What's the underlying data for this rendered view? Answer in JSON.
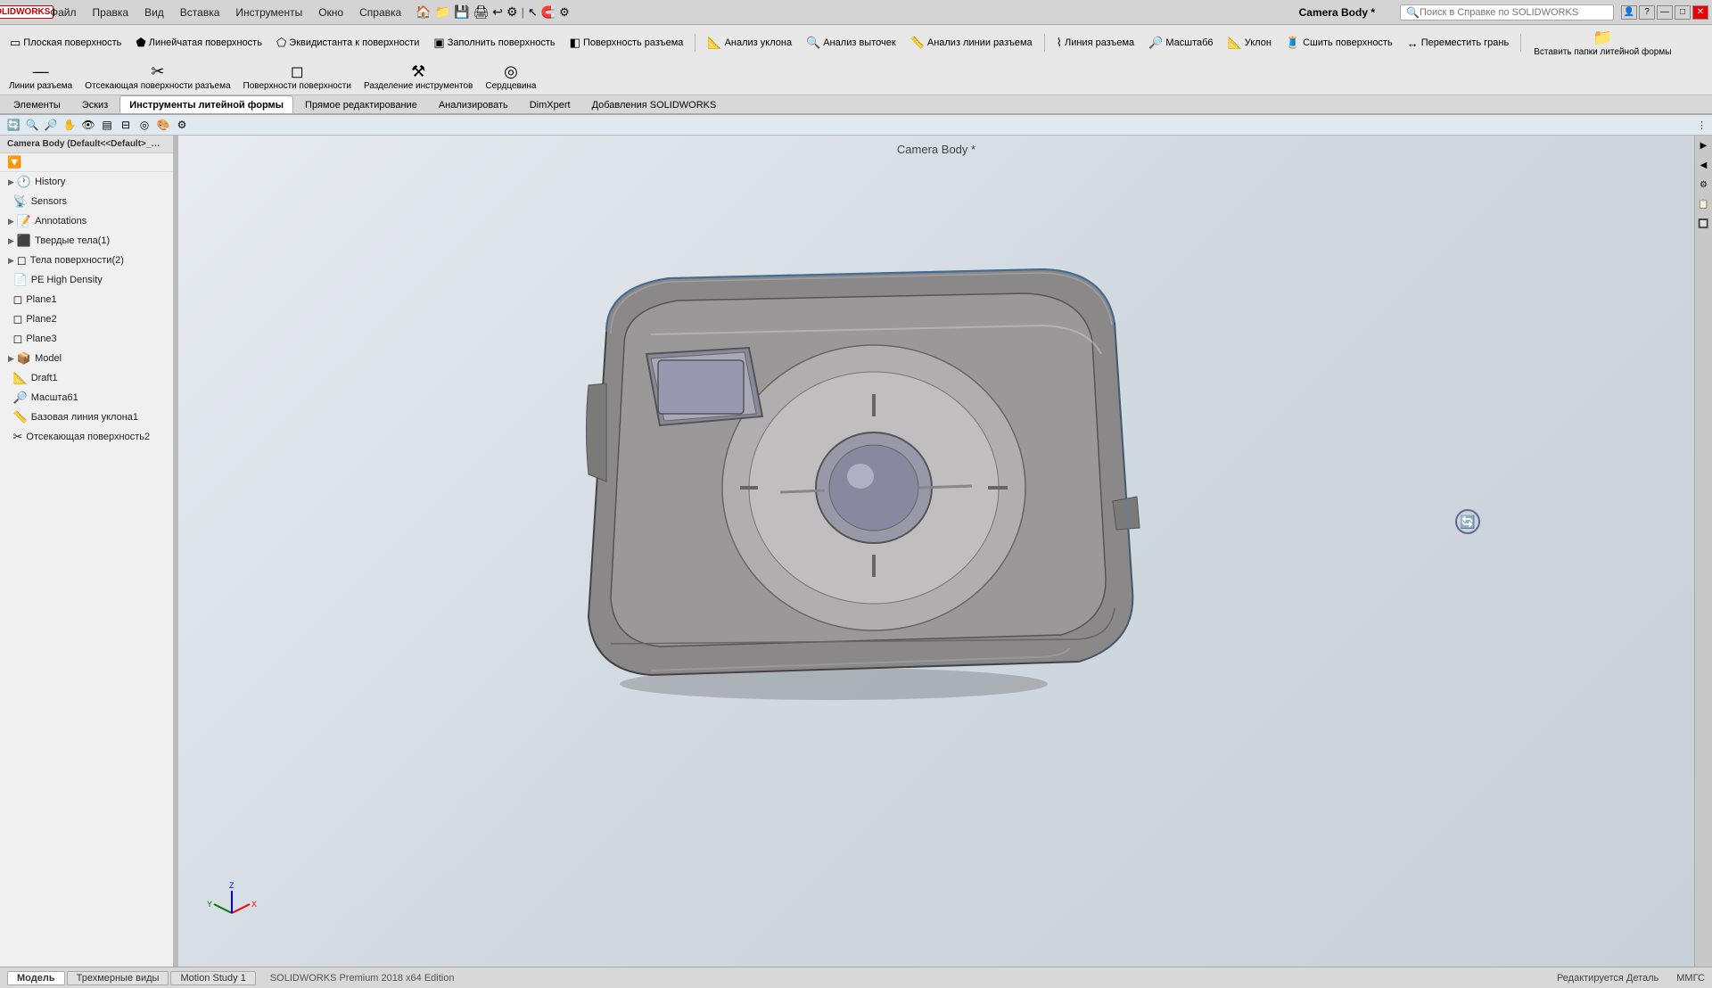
{
  "app": {
    "title": "Camera Body *",
    "logo": "SW",
    "company": "SOLIDWORKS"
  },
  "menubar": {
    "items": [
      "Файл",
      "Правка",
      "Вид",
      "Вставка",
      "Инструменты",
      "Окно",
      "Справка"
    ]
  },
  "search": {
    "placeholder": "Поиск в Справке по SOLIDWORKS",
    "value": ""
  },
  "toolbar1": {
    "items": [
      {
        "label": "Плоская поверхность",
        "icon": "▭"
      },
      {
        "label": "Линейчатая поверхность",
        "icon": "⬟"
      },
      {
        "label": "Эквидистанта к поверхности",
        "icon": "⬠"
      },
      {
        "label": "Заполнить поверхность",
        "icon": "▣"
      },
      {
        "label": "Поверхность разъема",
        "icon": "◧"
      },
      {
        "label": "Анализ уклона",
        "icon": "📐"
      },
      {
        "label": "Анализ выточек",
        "icon": "🔍"
      },
      {
        "label": "Анализ линии разъема",
        "icon": "📏"
      },
      {
        "label": "Линия разъема",
        "icon": "⌇"
      },
      {
        "label": "Масштаб6",
        "icon": "🔎"
      },
      {
        "label": "Уклон",
        "icon": "📐"
      },
      {
        "label": "Сшить поверхность",
        "icon": "🧵"
      },
      {
        "label": "Переместить грань",
        "icon": "↔"
      },
      {
        "label": "Вставить папки литейной формы",
        "icon": "📁"
      },
      {
        "label": "Линии разъема",
        "icon": "—"
      },
      {
        "label": "Отсекающая поверхности разъема",
        "icon": "✂"
      },
      {
        "label": "Поверхности поверхности",
        "icon": "◻"
      },
      {
        "label": "Разделение инструментов",
        "icon": "⚒"
      },
      {
        "label": "Сердцевина",
        "icon": "◎"
      }
    ]
  },
  "tabs": {
    "items": [
      "Элементы",
      "Эскиз",
      "Инструменты литейной формы",
      "Прямое редактирование",
      "Анализировать",
      "DimXpert",
      "Добавления SOLIDWORKS"
    ]
  },
  "sidebar": {
    "title": "Camera Body (Default<<Default>_Display",
    "filter_icon": "🔍",
    "tree": [
      {
        "label": "History",
        "icon": "🕐",
        "indent": 0,
        "arrow": "▶"
      },
      {
        "label": "Sensors",
        "icon": "📡",
        "indent": 0,
        "arrow": ""
      },
      {
        "label": "Annotations",
        "icon": "📝",
        "indent": 0,
        "arrow": "▶"
      },
      {
        "label": "Твердые тела(1)",
        "icon": "⬛",
        "indent": 0,
        "arrow": "▶"
      },
      {
        "label": "Тела поверхности(2)",
        "icon": "◻",
        "indent": 0,
        "arrow": "▶"
      },
      {
        "label": "PE High Density",
        "icon": "📄",
        "indent": 0,
        "arrow": ""
      },
      {
        "label": "Plane1",
        "icon": "◻",
        "indent": 0,
        "arrow": ""
      },
      {
        "label": "Plane2",
        "icon": "◻",
        "indent": 0,
        "arrow": ""
      },
      {
        "label": "Plane3",
        "icon": "◻",
        "indent": 0,
        "arrow": ""
      },
      {
        "label": "Model",
        "icon": "📦",
        "indent": 0,
        "arrow": "▶"
      },
      {
        "label": "Draft1",
        "icon": "📐",
        "indent": 0,
        "arrow": ""
      },
      {
        "label": "Масшта61",
        "icon": "🔎",
        "indent": 0,
        "arrow": ""
      },
      {
        "label": "Базовая линия уклона1",
        "icon": "📏",
        "indent": 0,
        "arrow": ""
      },
      {
        "label": "Отсекающая поверхность2",
        "icon": "✂",
        "indent": 0,
        "arrow": ""
      }
    ]
  },
  "viewport": {
    "title": "Camera Body *",
    "bg_color": "#d8e0e8"
  },
  "bottom": {
    "tabs": [
      "Модель",
      "Трехмерные виды",
      "Motion Study 1"
    ],
    "status_left": "SOLIDWORKS Premium 2018 x64 Edition",
    "status_mid": "Редактируется Деталь",
    "status_right": "ММГС"
  },
  "icons": {
    "search": "🔍",
    "filter": "⚗",
    "tree_arrow_right": "▶",
    "tree_arrow_down": "▼",
    "settings": "⚙",
    "close": "✕",
    "minimize": "—",
    "maximize": "□"
  }
}
